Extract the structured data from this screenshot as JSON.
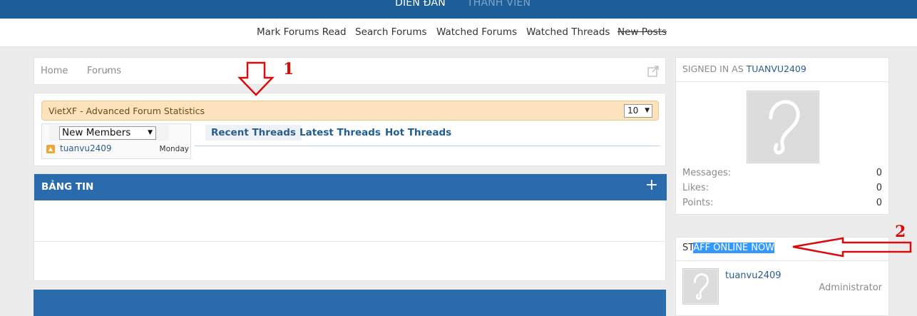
{
  "topnav": {
    "active_label": "DIỄN ĐÀN",
    "inactive_label": "THÀNH VIÊN"
  },
  "subnav": {
    "items": [
      "Mark Forums Read",
      "Search Forums",
      "Watched Forums",
      "Watched Threads",
      "New Posts"
    ]
  },
  "breadcrumb": {
    "home": "Home",
    "current": "Forums"
  },
  "stats": {
    "title": "VietXF - Advanced Forum Statistics",
    "count_value": "10",
    "member_select": "New Members",
    "member_name": "tuanvu2409",
    "member_day": "Monday",
    "tabs": [
      "Recent Threads",
      "Latest Threads",
      "Hot Threads"
    ]
  },
  "section": {
    "title": "BẢNG TIN",
    "toggle": "+"
  },
  "signed_in": {
    "prefix": "SIGNED IN AS",
    "username": "TUANVU2409",
    "messages_label": "Messages:",
    "messages_value": "0",
    "likes_label": "Likes:",
    "likes_value": "0",
    "points_label": "Points:",
    "points_value": "0"
  },
  "staff": {
    "title_start": "ST",
    "title_highlighted": "AFF ONLINE NOW",
    "member_name": "tuanvu2409",
    "member_role": "Administrator"
  },
  "annotations": {
    "label_1": "1",
    "label_2": "2",
    "arrow_color": "#d90b0b"
  },
  "colors": {
    "topbar": "#1d5e99",
    "section_header": "#2a6bad",
    "link": "#2b5c8e",
    "highlight": "#3399ff"
  }
}
